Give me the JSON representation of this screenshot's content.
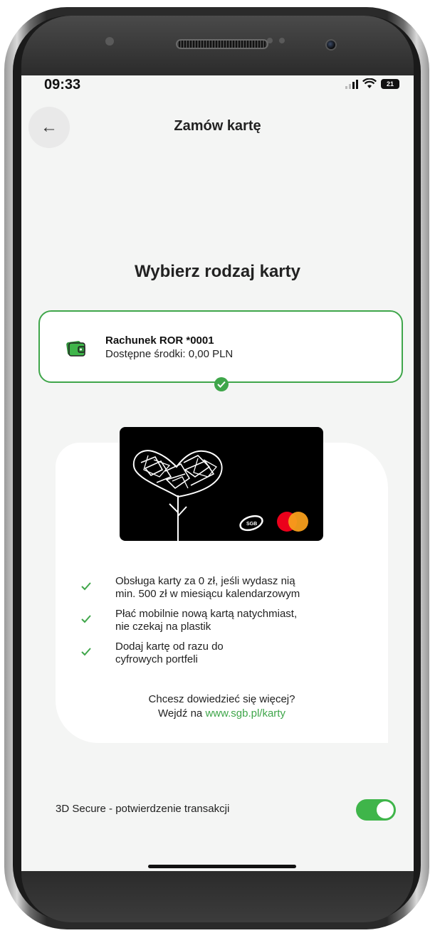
{
  "status_bar": {
    "time": "09:33",
    "battery": "21"
  },
  "header": {
    "title": "Zamów kartę",
    "back_icon": "arrow-left-icon"
  },
  "main": {
    "heading": "Wybierz rodzaj karty",
    "account": {
      "name": "Rachunek ROR *0001",
      "funds": "Dostępne środki: 0,00 PLN",
      "selected": true
    },
    "card_logos": {
      "sgb": "SGB"
    },
    "features": [
      {
        "line1": "Obsługa karty za 0 zł, jeśli wydasz nią",
        "line2": "min. 500 zł w miesiącu kalendarzowym"
      },
      {
        "line1": "Płać mobilnie nową kartą natychmiast,",
        "line2": "nie czekaj na plastik"
      },
      {
        "line1": "Dodaj kartę od razu do",
        "line2": "cyfrowych portfeli"
      }
    ],
    "more_info": {
      "question": "Chcesz dowiedzieć się więcej?",
      "prefix": "Wejdź na ",
      "link": "www.sgb.pl/karty"
    }
  },
  "settings": {
    "secure_label": "3D Secure - potwierdzenie transakcji",
    "secure_enabled": true
  },
  "colors": {
    "accent": "#3fa64a",
    "toggle_on": "#3fb54a",
    "card": "#000000"
  }
}
